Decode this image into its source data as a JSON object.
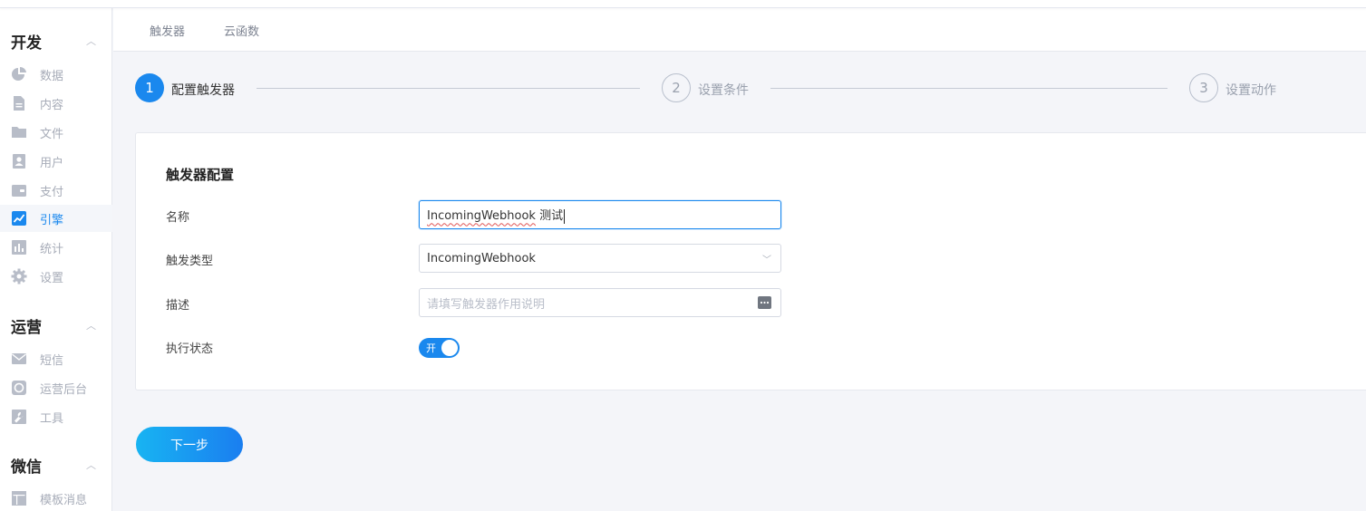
{
  "sidebar": {
    "groups": [
      {
        "title": "开发",
        "items": [
          {
            "label": "数据",
            "icon": "pie-chart-icon"
          },
          {
            "label": "内容",
            "icon": "document-icon"
          },
          {
            "label": "文件",
            "icon": "folder-icon"
          },
          {
            "label": "用户",
            "icon": "user-card-icon"
          },
          {
            "label": "支付",
            "icon": "wallet-icon"
          },
          {
            "label": "引擎",
            "icon": "trend-chart-icon",
            "active": true
          },
          {
            "label": "统计",
            "icon": "bar-chart-icon"
          },
          {
            "label": "设置",
            "icon": "gear-icon"
          }
        ]
      },
      {
        "title": "运营",
        "items": [
          {
            "label": "短信",
            "icon": "mail-icon"
          },
          {
            "label": "运营后台",
            "icon": "dashboard-icon"
          },
          {
            "label": "工具",
            "icon": "wrench-icon"
          }
        ]
      },
      {
        "title": "微信",
        "items": [
          {
            "label": "模板消息",
            "icon": "template-icon"
          }
        ]
      }
    ]
  },
  "tabs": [
    {
      "label": "触发器"
    },
    {
      "label": "云函数"
    }
  ],
  "steps": [
    {
      "number": "1",
      "label": "配置触发器",
      "active": true
    },
    {
      "number": "2",
      "label": "设置条件",
      "active": false
    },
    {
      "number": "3",
      "label": "设置动作",
      "active": false
    }
  ],
  "form": {
    "title": "触发器配置",
    "name": {
      "label": "名称",
      "value_part1": "IncomingWebhook",
      "value_part2": " 测试"
    },
    "trigger_type": {
      "label": "触发类型",
      "value": "IncomingWebhook"
    },
    "description": {
      "label": "描述",
      "placeholder": "请填写触发器作用说明"
    },
    "status": {
      "label": "执行状态",
      "toggle_text": "开",
      "on": true
    }
  },
  "next_button": {
    "label": "下一步"
  },
  "colors": {
    "accent": "#1a88ee",
    "sidebar_text": "#a7acb8",
    "background": "#f4f5f9"
  }
}
